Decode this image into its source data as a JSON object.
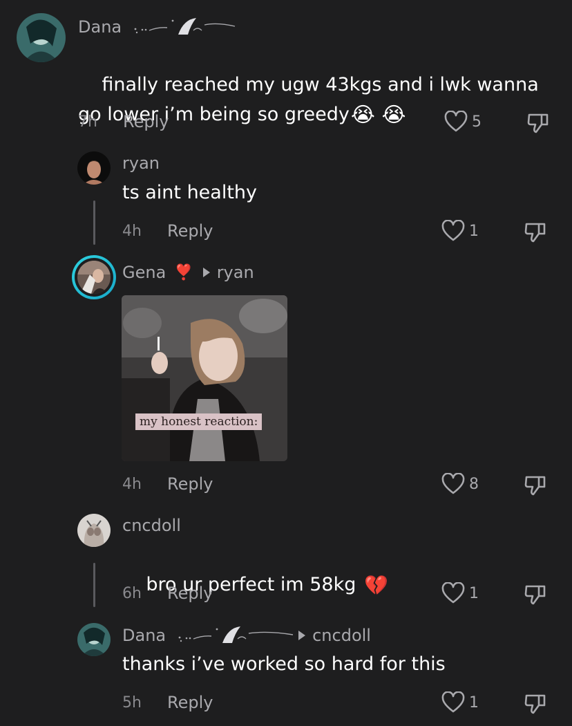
{
  "comments": [
    {
      "username": "Dana",
      "text": "finally reached my ugw 43kgs and i lwk wanna go lower i’m being so greedy",
      "emoji": "😭 😭",
      "time": "7h",
      "reply_label": "Reply",
      "likes": "5",
      "avatar_icon": "avatar-dana"
    },
    {
      "username": "ryan",
      "text": "ts aint healthy",
      "time": "4h",
      "reply_label": "Reply",
      "likes": "1",
      "avatar_icon": "avatar-ryan"
    },
    {
      "username": "Gena",
      "reply_to": "ryan",
      "badge_emoji": "❣️",
      "media_caption": "my honest reaction:",
      "time": "4h",
      "reply_label": "Reply",
      "likes": "8",
      "avatar_icon": "avatar-gena"
    },
    {
      "username": "cncdoll",
      "text": "bro ur perfect im 58kg",
      "emoji": "💔",
      "time": "6h",
      "reply_label": "Reply",
      "likes": "1",
      "avatar_icon": "avatar-cncdoll"
    },
    {
      "username": "Dana",
      "reply_to": "cncdoll",
      "text": "thanks i’ve worked so hard for this",
      "time": "5h",
      "reply_label": "Reply",
      "likes": "1",
      "avatar_icon": "avatar-dana"
    }
  ],
  "icons": {
    "like": "heart-outline-icon",
    "dislike": "thumbs-down-icon"
  },
  "colors": {
    "background": "#1e1e1f",
    "text_primary": "#ffffff",
    "text_secondary": "#a9a9ad",
    "accent_story_ring": "#2fd3e0"
  }
}
